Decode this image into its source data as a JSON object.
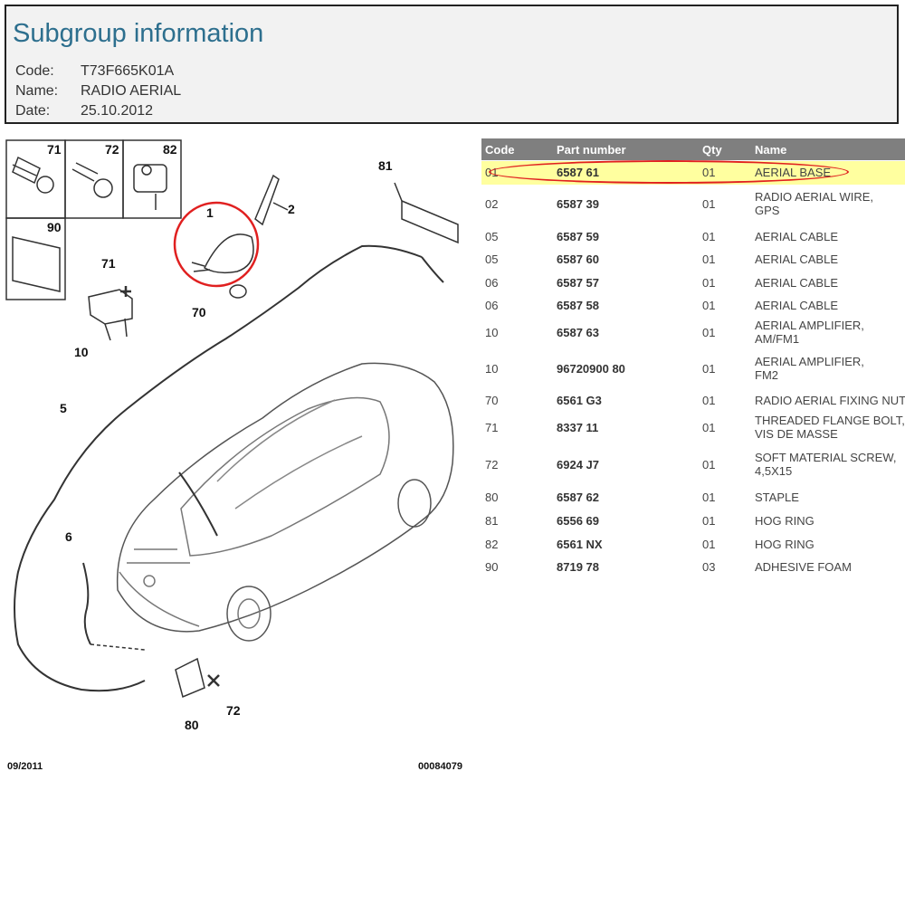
{
  "header": {
    "title": "Subgroup information",
    "code_label": "Code:",
    "code_value": "T73F665K01A",
    "name_label": "Name:",
    "name_value": "RADIO AERIAL",
    "date_label": "Date:",
    "date_value": "25.10.2012"
  },
  "diagram": {
    "footer_left": "09/2011",
    "footer_right": "00084079",
    "callouts": [
      "71",
      "72",
      "82",
      "90",
      "81",
      "2",
      "1",
      "71",
      "70",
      "10",
      "5",
      "6",
      "72",
      "80"
    ]
  },
  "table": {
    "headers": [
      "Code",
      "Part number",
      "Qty",
      "Name"
    ],
    "rows": [
      {
        "code": "01",
        "part": "6587 61",
        "qty": "01",
        "name": [
          "AERIAL BASE"
        ],
        "selected": true
      },
      {
        "code": "02",
        "part": "6587 39",
        "qty": "01",
        "name": [
          "RADIO AERIAL WIRE,",
          "GPS"
        ]
      },
      {
        "code": "05",
        "part": "6587 59",
        "qty": "01",
        "name": [
          "AERIAL CABLE"
        ]
      },
      {
        "code": "05",
        "part": "6587 60",
        "qty": "01",
        "name": [
          "AERIAL CABLE"
        ]
      },
      {
        "code": "06",
        "part": "6587 57",
        "qty": "01",
        "name": [
          "AERIAL CABLE"
        ]
      },
      {
        "code": "06",
        "part": "6587 58",
        "qty": "01",
        "name": [
          "AERIAL CABLE"
        ]
      },
      {
        "code": "10",
        "part": "6587 63",
        "qty": "01",
        "name": [
          "AERIAL AMPLIFIER,",
          "AM/FM1"
        ]
      },
      {
        "code": "10",
        "part": "96720900 80",
        "qty": "01",
        "name": [
          "AERIAL AMPLIFIER,",
          "FM2"
        ]
      },
      {
        "code": "70",
        "part": "6561 G3",
        "qty": "01",
        "name": [
          "RADIO AERIAL FIXING NUT"
        ]
      },
      {
        "code": "71",
        "part": "8337 11",
        "qty": "01",
        "name": [
          "THREADED FLANGE BOLT,",
          "VIS DE MASSE"
        ]
      },
      {
        "code": "72",
        "part": "6924 J7",
        "qty": "01",
        "name": [
          "SOFT MATERIAL SCREW,",
          "4,5X15"
        ]
      },
      {
        "code": "80",
        "part": "6587 62",
        "qty": "01",
        "name": [
          "STAPLE"
        ]
      },
      {
        "code": "81",
        "part": "6556 69",
        "qty": "01",
        "name": [
          "HOG RING"
        ]
      },
      {
        "code": "82",
        "part": "6561 NX",
        "qty": "01",
        "name": [
          "HOG RING"
        ]
      },
      {
        "code": "90",
        "part": "8719 78",
        "qty": "03",
        "name": [
          "ADHESIVE FOAM"
        ]
      }
    ]
  },
  "colors": {
    "title": "#2d6f8e",
    "table_header": "#7f7f7f",
    "selected_row": "#ffff9f",
    "highlight": "#e02020"
  }
}
